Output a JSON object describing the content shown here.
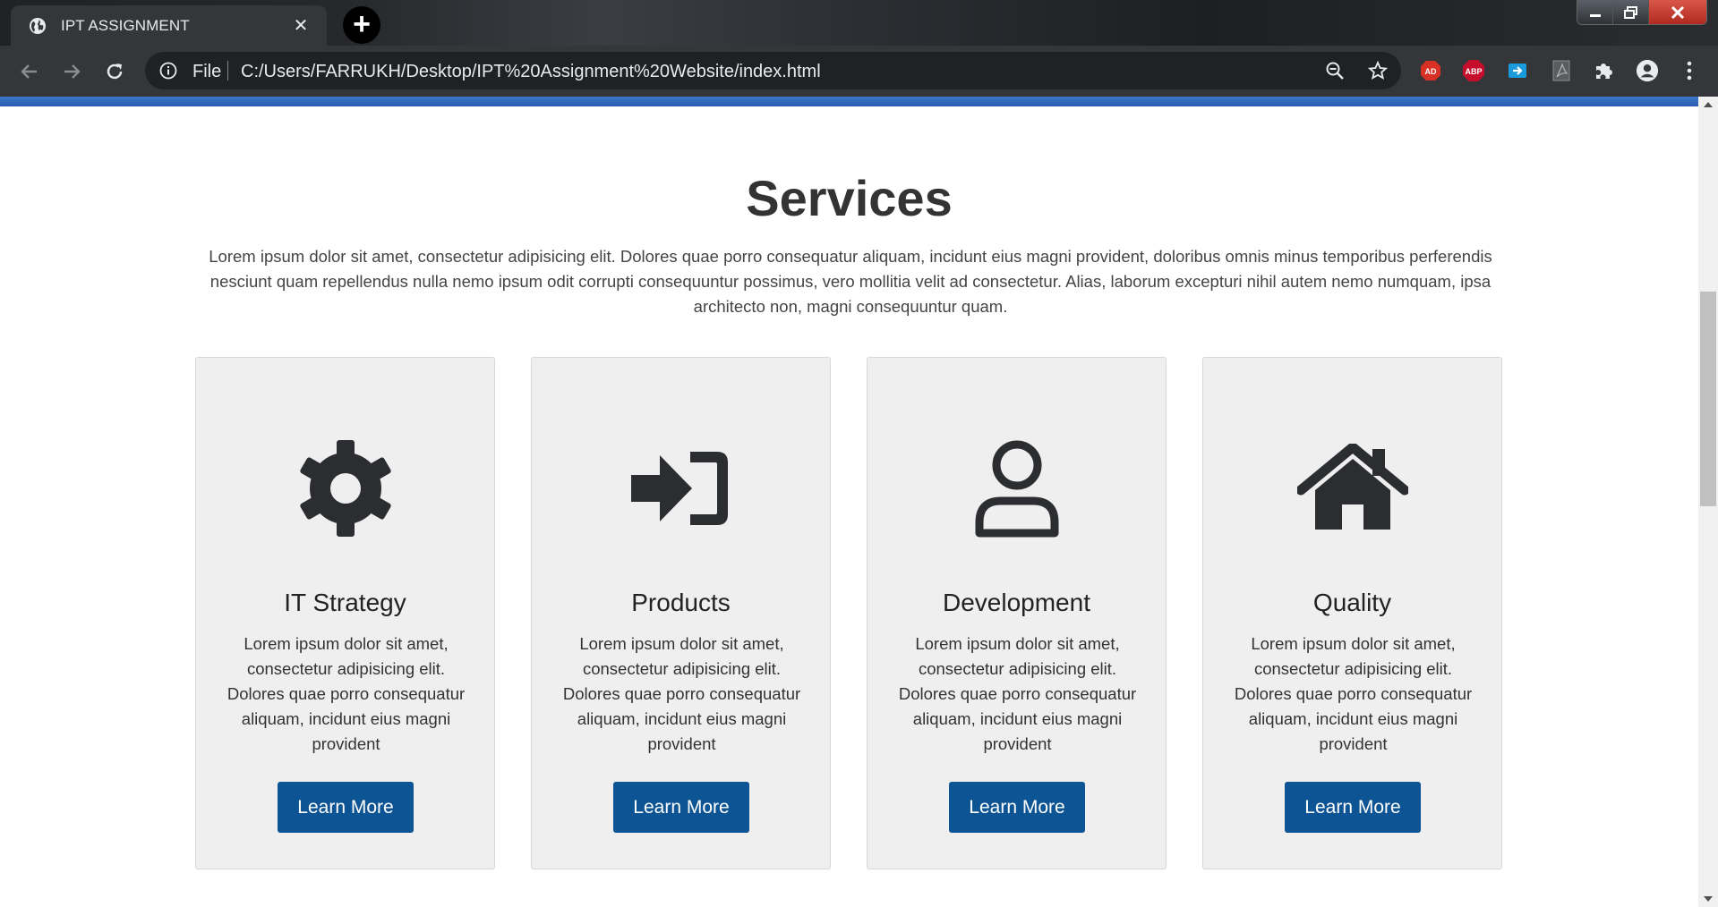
{
  "browser": {
    "tab_title": "IPT ASSIGNMENT",
    "new_tab_symbol": "+",
    "scheme_label": "File",
    "url": "C:/Users/FARRUKH/Desktop/IPT%20Assignment%20Website/index.html",
    "extensions": [
      "adblock-icon",
      "abp-icon",
      "cast-icon",
      "pdf-icon",
      "puzzle-icon"
    ],
    "abp_label": "ABP"
  },
  "services": {
    "title": "Services",
    "description": "Lorem ipsum dolor sit amet, consectetur adipisicing elit. Dolores quae porro consequatur aliquam, incidunt eius magni provident, doloribus omnis minus temporibus perferendis nesciunt quam repellendus nulla nemo ipsum odit corrupti consequuntur possimus, vero mollitia velit ad consectetur. Alias, laborum excepturi nihil autem nemo numquam, ipsa architecto non, magni consequuntur quam.",
    "cards": [
      {
        "icon": "gear-icon",
        "title": "IT Strategy",
        "text": "Lorem ipsum dolor sit amet, consectetur adipisicing elit. Dolores quae porro consequatur aliquam, incidunt eius magni provident",
        "button": "Learn More"
      },
      {
        "icon": "sign-in-icon",
        "title": "Products",
        "text": "Lorem ipsum dolor sit amet, consectetur adipisicing elit. Dolores quae porro consequatur aliquam, incidunt eius magni provident",
        "button": "Learn More"
      },
      {
        "icon": "user-icon",
        "title": "Development",
        "text": "Lorem ipsum dolor sit amet, consectetur adipisicing elit. Dolores quae porro consequatur aliquam, incidunt eius magni provident",
        "button": "Learn More"
      },
      {
        "icon": "home-icon",
        "title": "Quality",
        "text": "Lorem ipsum dolor sit amet, consectetur adipisicing elit. Dolores quae porro consequatur aliquam, incidunt eius magni provident",
        "button": "Learn More"
      }
    ]
  },
  "colors": {
    "accent_strip": "#2a5fb3",
    "button": "#0d5494",
    "card_bg": "#efefef"
  }
}
